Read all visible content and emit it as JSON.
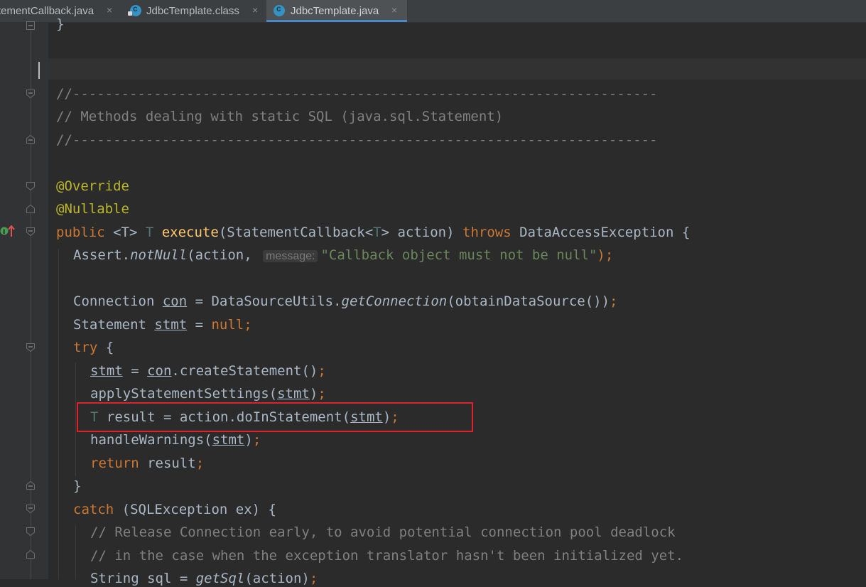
{
  "tabs": [
    {
      "label": "tementCallback.java",
      "close": "×"
    },
    {
      "label": "JdbcTemplate.class",
      "close": "×",
      "icon": "class-icon"
    },
    {
      "label": "JdbcTemplate.java",
      "close": "×",
      "icon": "java-class-icon"
    }
  ],
  "editor": {
    "lines": {
      "l0": "}",
      "l1": "//------------------------------------------------------------------------",
      "l2": "// Methods dealing with static SQL (java.sql.Statement)",
      "l3": "//------------------------------------------------------------------------",
      "l4": "@Override",
      "l5": "@Nullable",
      "l6a": "public ",
      "l6b": "<T> ",
      "l6c": "T ",
      "l6d": "execute",
      "l6e": "(StatementCallback<",
      "l6f": "T",
      "l6g": "> action) ",
      "l6h": "throws ",
      "l6i": "DataAccessException {",
      "l7a": "Assert.",
      "l7b": "notNull",
      "l7c": "(action, ",
      "l7hint": "message:",
      "l7d": "\"Callback object must not be null\"",
      "l7e": ");",
      "l8a": "Connection ",
      "l8b": "con",
      "l8c": " = DataSourceUtils.",
      "l8d": "getConnection",
      "l8e": "(obtainDataSource())",
      "l8f": ";",
      "l9a": "Statement ",
      "l9b": "stmt",
      "l9c": " = ",
      "l9d": "null",
      "l9e": ";",
      "l10a": "try",
      "l10b": " {",
      "l11a": "stmt",
      "l11b": " = ",
      "l11c": "con",
      "l11d": ".createStatement()",
      "l11e": ";",
      "l12a": "applyStatementSettings(",
      "l12b": "stmt",
      "l12c": ")",
      "l12d": ";",
      "l13a": "T ",
      "l13b": "result = action.doInStatement(",
      "l13c": "stmt",
      "l13d": ")",
      "l13e": ";",
      "l14a": "handleWarnings(",
      "l14b": "stmt",
      "l14c": ")",
      "l14d": ";",
      "l15a": "return ",
      "l15b": "result",
      "l15c": ";",
      "l16": "}",
      "l17a": "catch ",
      "l17b": "(SQLException ex) {",
      "l18": "// Release Connection early, to avoid potential connection pool deadlock",
      "l19": "// in the case when the exception translator hasn't been initialized yet.",
      "l20a": "String sql = ",
      "l20b": "getSql",
      "l20c": "(action)",
      "l20d": ";"
    }
  },
  "gutter_icon": "implementation-override-icon",
  "colors": {
    "background": "#2b2b2b",
    "keyword": "#cc7832",
    "annotation": "#bbb529",
    "comment": "#808080",
    "string": "#6a8759",
    "method_decl": "#ffc66d",
    "highlight_border": "#e0202a"
  }
}
